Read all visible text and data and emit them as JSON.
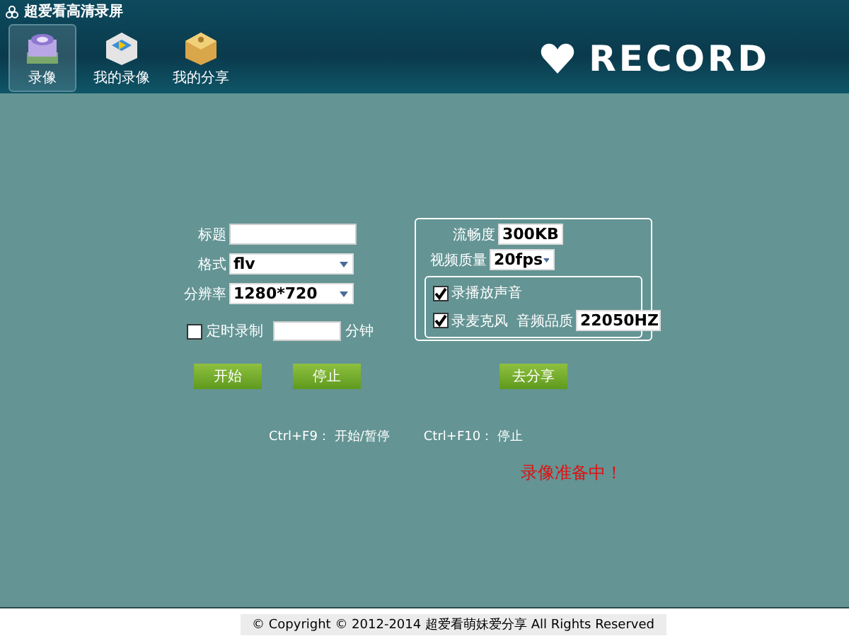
{
  "window": {
    "title": "超爱看高清录屏"
  },
  "toolbar": [
    {
      "label": "录像",
      "selected": true,
      "kind": "record"
    },
    {
      "label": "我的录像",
      "selected": false,
      "kind": "video"
    },
    {
      "label": "我的分享",
      "selected": false,
      "kind": "share"
    }
  ],
  "logo": {
    "text": "RECORD"
  },
  "form": {
    "title": {
      "label": "标题"
    },
    "format": {
      "label": "格式",
      "value": "flv"
    },
    "resolution": {
      "label": "分辨率",
      "value": "1280*720"
    },
    "timer": {
      "label": "定时录制",
      "checked": false,
      "unit": "分钟"
    }
  },
  "settings": {
    "bitrate": {
      "label": "流畅度",
      "value": "300KB"
    },
    "quality": {
      "label": "视频质量",
      "value": "20fps"
    },
    "audio": {
      "system_sound": {
        "label": "录播放声音",
        "checked": true
      },
      "microphone": {
        "label": "录麦克风",
        "checked": true
      },
      "audio_quality": {
        "label": "音频品质",
        "value": "22050HZ"
      }
    }
  },
  "buttons": [
    {
      "label": "开始"
    },
    {
      "label": "停止"
    },
    {
      "label": "去分享"
    }
  ],
  "shortcuts": [
    {
      "keys": "Ctrl+F9：",
      "action": "开始/暂停"
    },
    {
      "keys": "Ctrl+F10：",
      "action": "停止"
    }
  ],
  "status": "录像准备中！",
  "footer": "© Copyright © 2012-2014 超爱看萌妹爱分享 All Rights Reserved"
}
